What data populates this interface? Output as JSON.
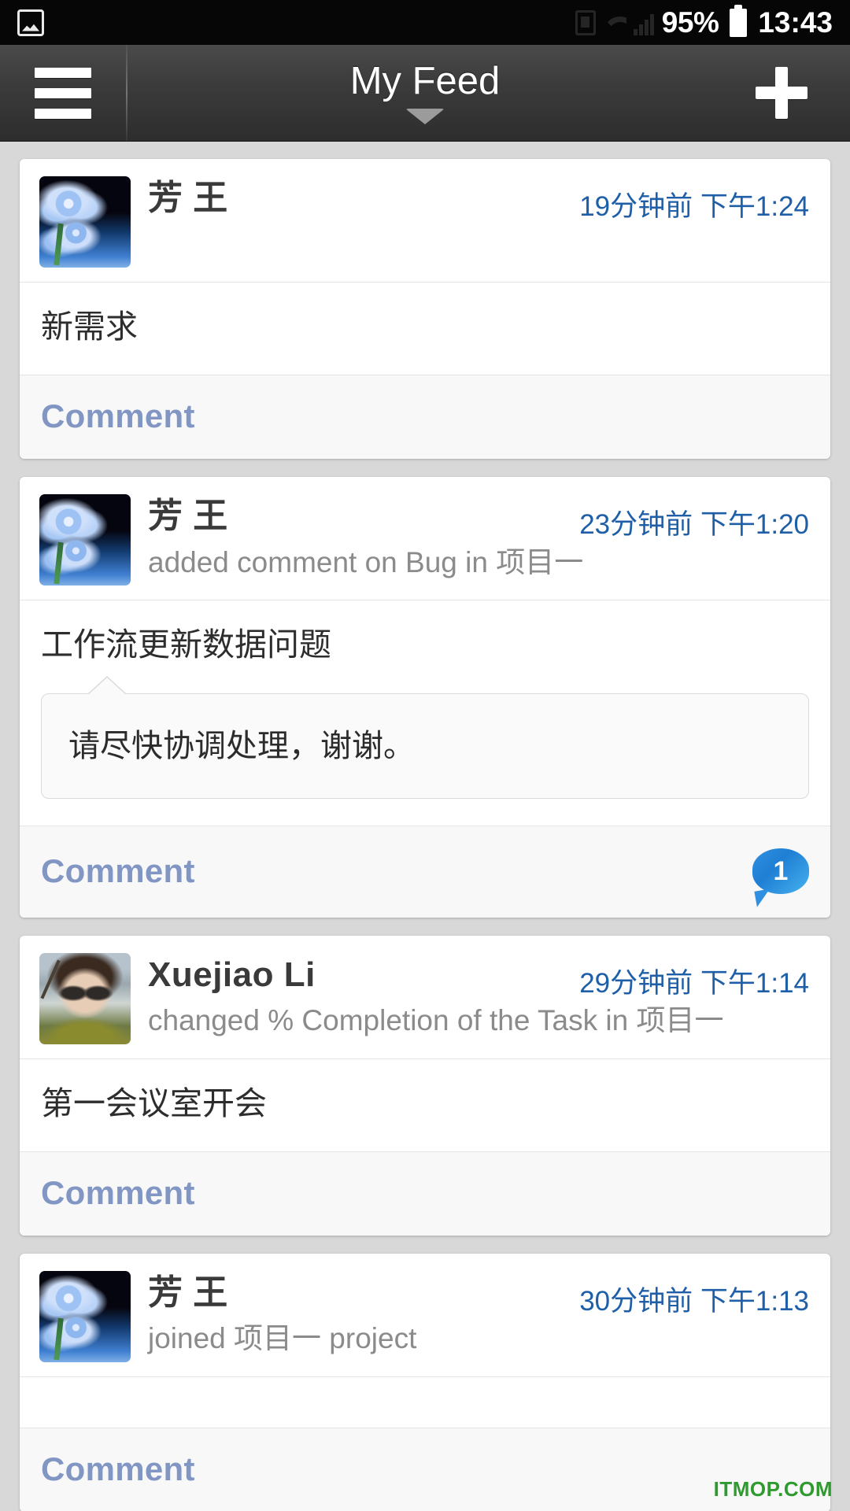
{
  "status_bar": {
    "left_icon": "gallery-icon",
    "icons": [
      "sim-card-icon",
      "wifi-icon",
      "signal-bars-icon"
    ],
    "battery_percent": "95%",
    "battery_icon": "battery-icon",
    "clock": "13:43"
  },
  "app_bar": {
    "menu_icon": "hamburger-menu-icon",
    "title": "My Feed",
    "dropdown_icon": "chevron-down-icon",
    "add_icon": "plus-icon"
  },
  "colors": {
    "accent_blue": "#1f5fa8",
    "comment_link": "#8296c4",
    "badge_blue": "#2f8fe0",
    "card_bg": "#ffffff",
    "page_bg": "#d8d8d8",
    "watermark_green": "#2f9a2f"
  },
  "feed": {
    "comment_label": "Comment",
    "cards": [
      {
        "avatar": "flowers",
        "name": "芳 王",
        "subtitle": "",
        "timestamp": "19分钟前 下午1:24",
        "body_title": "新需求",
        "bubble_text": "",
        "comment_count": ""
      },
      {
        "avatar": "flowers",
        "name": "芳 王",
        "subtitle": "added comment on Bug in 项目一",
        "timestamp": "23分钟前 下午1:20",
        "body_title": "工作流更新数据问题",
        "bubble_text": "请尽快协调处理，谢谢。",
        "comment_count": "1"
      },
      {
        "avatar": "photo",
        "name": "Xuejiao Li",
        "subtitle": "changed % Completion of the Task in 项目一",
        "timestamp": "29分钟前 下午1:14",
        "body_title": "第一会议室开会",
        "bubble_text": "",
        "comment_count": ""
      },
      {
        "avatar": "flowers",
        "name": "芳 王",
        "subtitle": "joined 项目一 project",
        "timestamp": "30分钟前 下午1:13",
        "body_title": "",
        "bubble_text": "",
        "comment_count": ""
      }
    ]
  },
  "watermark": "ITMOP.COM"
}
